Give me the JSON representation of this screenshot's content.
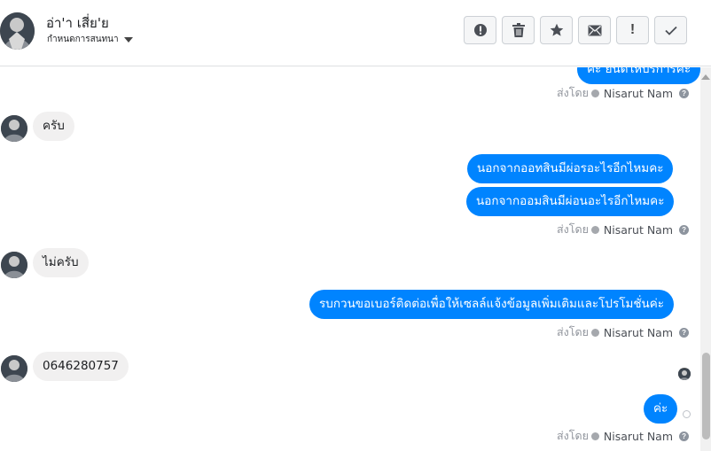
{
  "header": {
    "contact_name": "อ่า'า เสี่ย'ย",
    "contact_sub": "กำหนดการสนทนา",
    "toolbar": [
      {
        "name": "report-button",
        "icon": "exclamation-circle-icon"
      },
      {
        "name": "delete-button",
        "icon": "trash-icon"
      },
      {
        "name": "star-button",
        "icon": "star-icon"
      },
      {
        "name": "mark-unread-button",
        "icon": "envelope-icon"
      },
      {
        "name": "priority-button",
        "icon": "exclamation-icon",
        "label": "!"
      },
      {
        "name": "done-button",
        "icon": "check-icon"
      }
    ]
  },
  "messages": {
    "top_partial_text": "ค่ะ ยินดีให้บริการค่ะ",
    "sent_by_label": "ส่งโดย",
    "sent_by_name": "Nisarut Nam",
    "help_glyph": "?",
    "in_1": "ครับ",
    "out_1": "นอกจากออทสินมีผ่อรอะไรอีกไหมคะ",
    "out_2": "นอกจากออมสินมีผ่อนอะไรอีกไหมคะ",
    "in_2": "ไม่ครับ",
    "out_3": "รบกวนขอเบอร์ติดต่อเพื่อให้เซลล์แจ้งข้อมูลเพิ่มเติมและโปรโมชั่นค่ะ",
    "in_3": "0646280757",
    "out_4": "ค่ะ"
  },
  "colors": {
    "outgoing_bubble": "#0084ff",
    "incoming_bubble": "#f1f0f0",
    "sender_name": "#4b4f56"
  }
}
